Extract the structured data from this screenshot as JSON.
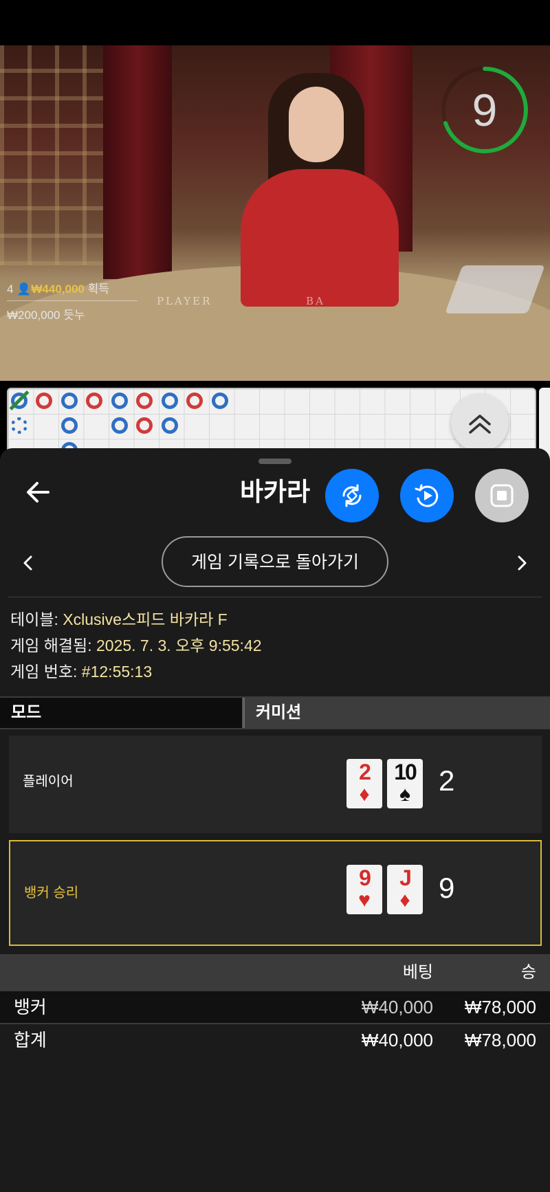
{
  "video": {
    "timer": "9",
    "winners": {
      "count": "4",
      "amount": "₩440,000",
      "suffix": "획득"
    },
    "winnings_line": "₩200,000 듯누",
    "felt_player": "PLAYER",
    "felt_banker": "BA"
  },
  "panel": {
    "title": "바카라",
    "history_button": "게임 기록으로 돌아가기",
    "info": {
      "table_label": "테이블:",
      "table_value": " Xclusive스피드 바카라 F",
      "resolved_label": "게임 해결됨:",
      "resolved_value": " 2025. 7. 3. 오후 9:55:42",
      "number_label": "게임 번호:",
      "number_value": " #12:55:13"
    },
    "tabs": [
      "모드",
      "커미션"
    ],
    "player": {
      "label": "플레이어",
      "cards": [
        {
          "rank": "2",
          "suit": "♦"
        },
        {
          "rank": "10",
          "suit": "♠"
        }
      ],
      "score": "2"
    },
    "banker": {
      "label": "뱅커 승리",
      "cards": [
        {
          "rank": "9",
          "suit": "♥"
        },
        {
          "rank": "J",
          "suit": "♦"
        }
      ],
      "score": "9"
    },
    "bets": {
      "headers": {
        "bet": "베팅",
        "win": "승"
      },
      "rows": [
        {
          "name": "뱅커",
          "bet": "₩40,000",
          "win": "₩78,000"
        },
        {
          "name": "합계",
          "bet": "₩40,000",
          "win": "₩78,000"
        }
      ]
    }
  },
  "colors": {
    "accent_blue": "#0a7aff",
    "winner_gold": "#e8c43a",
    "timer_green": "#1faa3c"
  }
}
